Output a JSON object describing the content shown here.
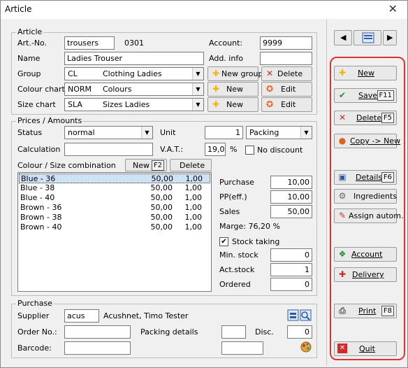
{
  "window": {
    "title": "Article",
    "close_glyph": "✕"
  },
  "article": {
    "legend": "Article",
    "artno_label": "Art.-No.",
    "artno_value": "trousers",
    "artno_code": "0301",
    "account_label": "Account:",
    "account_value": "9999",
    "name_label": "Name",
    "name_value": "Ladies Trouser",
    "addinfo_label": "Add. info",
    "addinfo_value": "",
    "group_label": "Group",
    "group_code": "CL",
    "group_name": "Clothing Ladies",
    "colour_label": "Colour chart",
    "colour_code": "NORM",
    "colour_name": "Colours",
    "size_label": "Size chart",
    "size_code": "SLA",
    "size_name": "Sizes Ladies",
    "btn_new_group": "New group",
    "btn_delete": "Delete",
    "btn_new": "New",
    "btn_edit": "Edit"
  },
  "prices": {
    "legend": "Prices / Amounts",
    "status_label": "Status",
    "status_value": "normal",
    "unit_label": "Unit",
    "unit_value": "1",
    "unit_type": "Packing",
    "calc_label": "Calculation",
    "calc_value": "",
    "vat_label": "V.A.T.:",
    "vat_value": "19,0",
    "vat_unit": "%",
    "no_discount_label": "No discount",
    "combo_label": "Colour / Size combination",
    "combo_new": "New",
    "combo_new_key": "F2",
    "combo_delete": "Delete",
    "combinations": [
      {
        "name": "Blue - 36",
        "price": "50,00",
        "qty": "1,00"
      },
      {
        "name": "Blue - 38",
        "price": "50,00",
        "qty": "1,00"
      },
      {
        "name": "Blue - 40",
        "price": "50,00",
        "qty": "1,00"
      },
      {
        "name": "Brown - 36",
        "price": "50,00",
        "qty": "1,00"
      },
      {
        "name": "Brown - 38",
        "price": "50,00",
        "qty": "1,00"
      },
      {
        "name": "Brown - 40",
        "price": "50,00",
        "qty": "1,00"
      }
    ],
    "purchase_label": "Purchase",
    "purchase_value": "10,00",
    "ppeff_label": "PP(eff.)",
    "ppeff_value": "10,00",
    "sales_label": "Sales",
    "sales_value": "50,00",
    "marge_text": "Marge: 76,20 %",
    "stock_taking_label": "Stock taking",
    "min_stock_label": "Min. stock",
    "min_stock_value": "0",
    "act_stock_label": "Act.stock",
    "act_stock_value": "1",
    "ordered_label": "Ordered",
    "ordered_value": "0"
  },
  "purchase": {
    "legend": "Purchase",
    "supplier_label": "Supplier",
    "supplier_code": "acus",
    "supplier_name": "Acushnet, Timo Tester",
    "order_label": "Order No.:",
    "order_value": "",
    "packing_label": "Packing details",
    "packing_value": "",
    "disc_label": "Disc.",
    "disc_value": "0",
    "barcode_label": "Barcode:",
    "barcode_value": ""
  },
  "sidebar": {
    "new": "New",
    "save": "Save",
    "save_key": "F11",
    "delete": "Delete",
    "delete_key": "F5",
    "copy": "Copy -> New",
    "details": "Details",
    "details_key": "F6",
    "ingredients": "Ingredients",
    "assign": "Assign autom.",
    "account": "Account",
    "delivery": "Delivery",
    "print": "Print",
    "print_key": "F8",
    "quit": "Quit"
  },
  "colors": {
    "highlight": "#e03131",
    "selection": "#cde2f7",
    "new_icon": "#f2b400",
    "delete_icon": "#d62828",
    "save_icon": "#1e8a2e"
  }
}
